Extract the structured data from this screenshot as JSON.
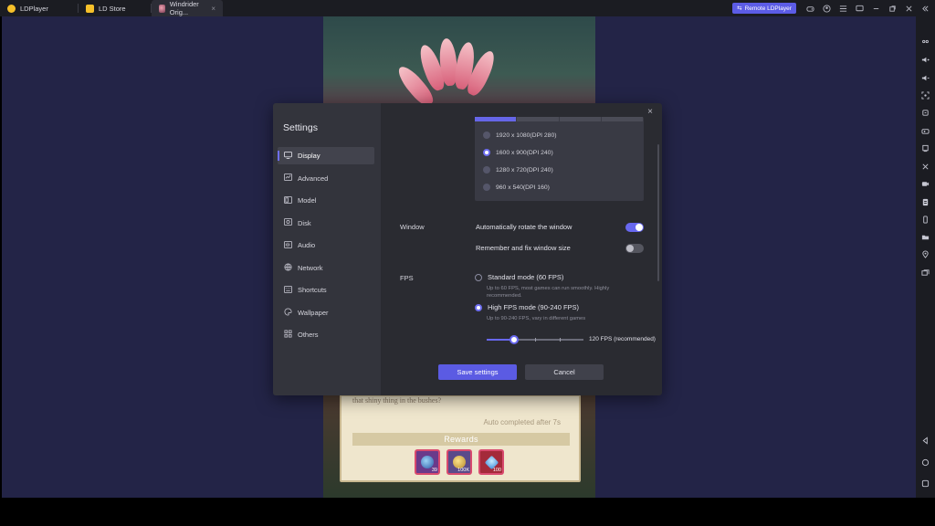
{
  "titlebar": {
    "tabs": [
      {
        "label": "LDPlayer",
        "icon": "ldplayer-logo-icon"
      },
      {
        "label": "LD Store",
        "icon": "store-icon"
      },
      {
        "label": "Windrider Orig...",
        "icon": "game-icon",
        "close": "×"
      }
    ],
    "remote_button": "Remote LDPlayer",
    "icons": [
      "gamepad-icon",
      "user-icon",
      "menu-icon",
      "display-icon",
      "minimize-icon",
      "restore-icon",
      "close-icon",
      "collapse-icon"
    ],
    "remote_icon_glyph": "⇆"
  },
  "game": {
    "quest_text": "that shiny thing in the bushes?",
    "auto_completed": "Auto completed after 7s",
    "rewards_title": "Rewards",
    "rewards": [
      {
        "count": "39",
        "icon": "orb-icon"
      },
      {
        "count": "100K",
        "icon": "coin-icon"
      },
      {
        "count": "100",
        "icon": "diamond-icon"
      }
    ]
  },
  "settings": {
    "title": "Settings",
    "close_glyph": "×",
    "nav": [
      {
        "label": "Display",
        "icon": "display-icon",
        "active": true
      },
      {
        "label": "Advanced",
        "icon": "advanced-icon",
        "active": false
      },
      {
        "label": "Model",
        "icon": "model-icon",
        "active": false
      },
      {
        "label": "Disk",
        "icon": "disk-icon",
        "active": false
      },
      {
        "label": "Audio",
        "icon": "audio-icon",
        "active": false
      },
      {
        "label": "Network",
        "icon": "network-icon",
        "active": false
      },
      {
        "label": "Shortcuts",
        "icon": "shortcuts-icon",
        "active": false
      },
      {
        "label": "Wallpaper",
        "icon": "wallpaper-icon",
        "active": false
      },
      {
        "label": "Others",
        "icon": "others-icon",
        "active": false
      }
    ],
    "resolutions": [
      {
        "label": "1920 x 1080(DPI 280)",
        "selected": false
      },
      {
        "label": "1600 x 900(DPI 240)",
        "selected": true
      },
      {
        "label": "1280 x 720(DPI 240)",
        "selected": false
      },
      {
        "label": "960 x 540(DPI 160)",
        "selected": false
      }
    ],
    "window": {
      "label": "Window",
      "auto_rotate": {
        "label": "Automatically rotate the window",
        "on": true
      },
      "fix_size": {
        "label": "Remember and fix window size",
        "on": false
      }
    },
    "fps": {
      "label": "FPS",
      "standard": {
        "label": "Standard mode (60 FPS)",
        "desc": "Up to 60 FPS, most games can run smoothly. Highly recommended.",
        "selected": false
      },
      "high": {
        "label": "High FPS mode (90-240 FPS)",
        "desc": "Up to 90-240 FPS, vary in different games",
        "selected": true
      },
      "slider_value": "120 FPS (recommended)",
      "slider_fraction": 0.28
    },
    "save_label": "Save settings",
    "cancel_label": "Cancel"
  },
  "colors": {
    "accent": "#5b5be3",
    "background": "#232447",
    "dialog": "#2a2b31"
  },
  "sidebar_icons": [
    "keyboard-icon",
    "volume-up-icon",
    "volume-down-icon",
    "screenshot-icon",
    "apk-icon",
    "gamepad-icon",
    "shake-icon",
    "record-icon",
    "script-icon",
    "sync-icon",
    "folder-icon",
    "location-icon",
    "multi-instance-icon",
    "back-icon",
    "home-icon",
    "recent-apps-icon"
  ]
}
